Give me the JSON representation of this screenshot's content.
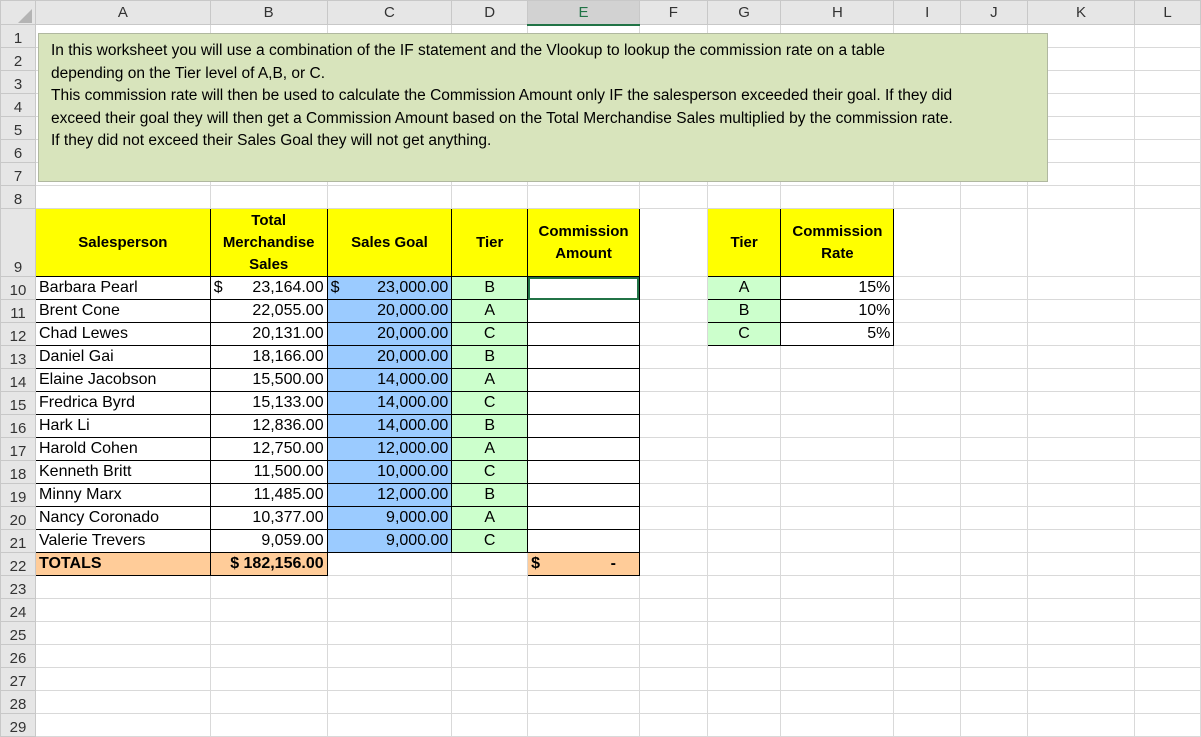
{
  "columns": [
    "A",
    "B",
    "C",
    "D",
    "E",
    "F",
    "G",
    "H",
    "I",
    "J",
    "K",
    "L"
  ],
  "selected_column": "E",
  "note_lines": [
    "In this worksheet you will use a combination of the IF statement and the Vlookup to lookup the commission rate on a table",
    "depending on the Tier level of A,B, or C.",
    "This commission rate will then be used to calculate the Commission Amount only IF the salesperson exceeded their goal. If they did",
    "exceed their goal they will then get a Commission Amount based on the Total Merchandise Sales multiplied by the commission rate.",
    "If they did not exceed their Sales Goal they will not get anything."
  ],
  "headers": {
    "salesperson": "Salesperson",
    "total_sales": "Total Merchandise Sales",
    "sales_goal": "Sales Goal",
    "tier": "Tier",
    "commission_amount": "Commission Amount",
    "rate_tier": "Tier",
    "commission_rate": "Commission Rate"
  },
  "currency": "$",
  "rows": [
    {
      "name": "Barbara Pearl",
      "sales": "23,164.00",
      "goal": "23,000.00",
      "tier": "B"
    },
    {
      "name": "Brent Cone",
      "sales": "22,055.00",
      "goal": "20,000.00",
      "tier": "A"
    },
    {
      "name": "Chad Lewes",
      "sales": "20,131.00",
      "goal": "20,000.00",
      "tier": "C"
    },
    {
      "name": "Daniel Gai",
      "sales": "18,166.00",
      "goal": "20,000.00",
      "tier": "B"
    },
    {
      "name": "Elaine Jacobson",
      "sales": "15,500.00",
      "goal": "14,000.00",
      "tier": "A"
    },
    {
      "name": "Fredrica Byrd",
      "sales": "15,133.00",
      "goal": "14,000.00",
      "tier": "C"
    },
    {
      "name": "Hark Li",
      "sales": "12,836.00",
      "goal": "14,000.00",
      "tier": "B"
    },
    {
      "name": "Harold Cohen",
      "sales": "12,750.00",
      "goal": "12,000.00",
      "tier": "A"
    },
    {
      "name": "Kenneth Britt",
      "sales": "11,500.00",
      "goal": "10,000.00",
      "tier": "C"
    },
    {
      "name": "Minny Marx",
      "sales": "11,485.00",
      "goal": "12,000.00",
      "tier": "B"
    },
    {
      "name": "Nancy Coronado",
      "sales": "10,377.00",
      "goal": "9,000.00",
      "tier": "A"
    },
    {
      "name": "Valerie Trevers",
      "sales": "9,059.00",
      "goal": "9,000.00",
      "tier": "C"
    }
  ],
  "rates": [
    {
      "tier": "A",
      "rate": "15%"
    },
    {
      "tier": "B",
      "rate": "10%"
    },
    {
      "tier": "C",
      "rate": "5%"
    }
  ],
  "totals": {
    "label": "TOTALS",
    "sales": "$ 182,156.00",
    "commission_currency": "$",
    "commission": "-"
  }
}
